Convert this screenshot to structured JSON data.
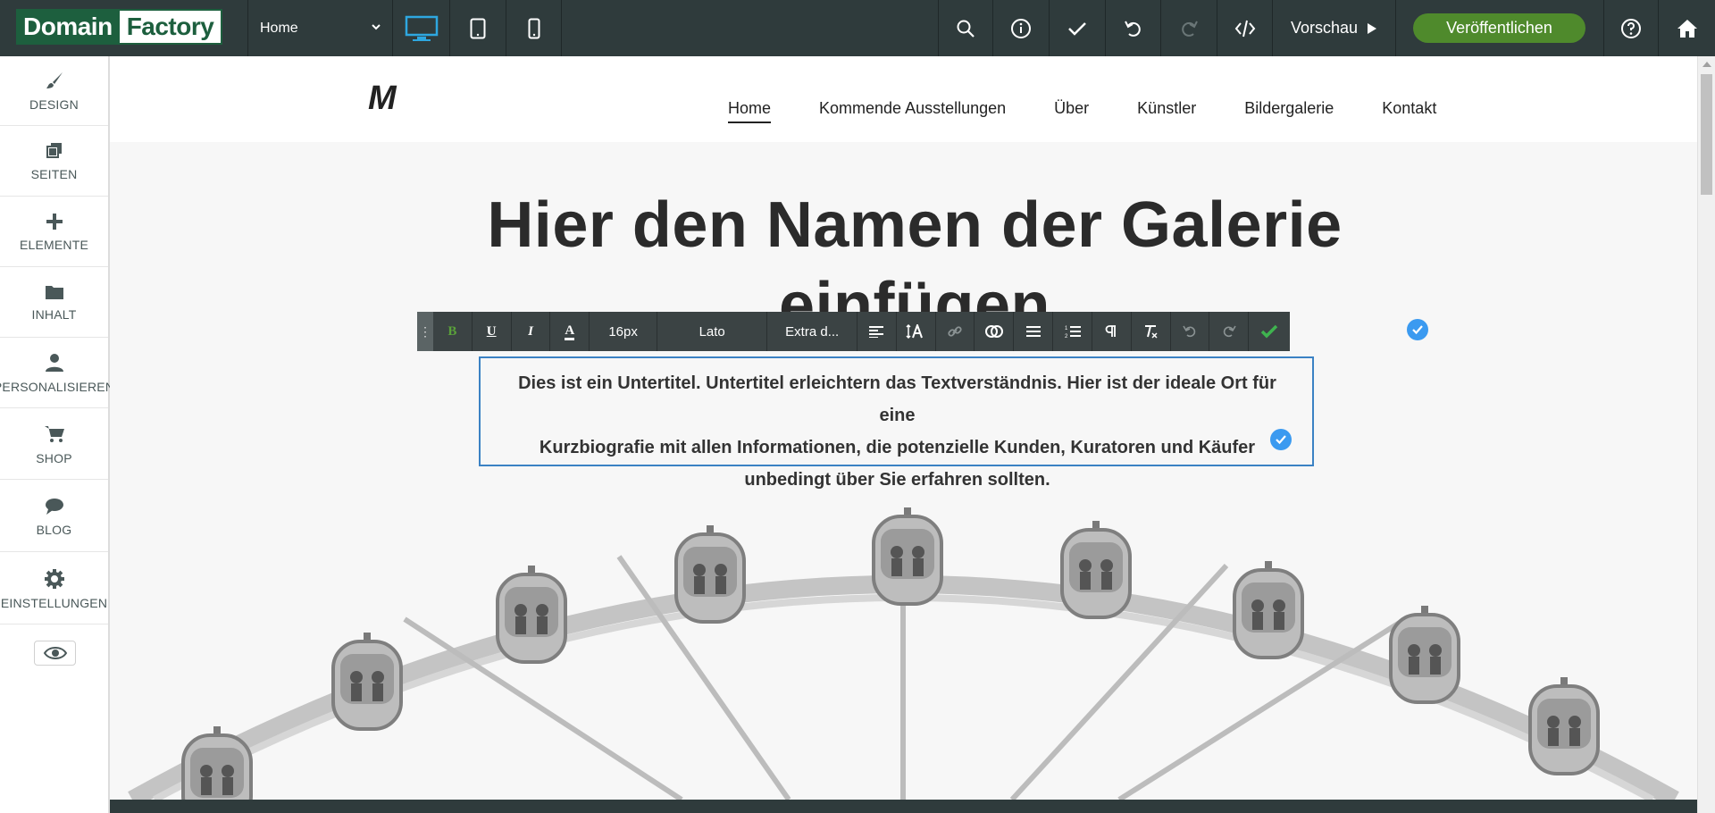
{
  "topbar": {
    "logo_part1": "Domain",
    "logo_part2": "Factory",
    "page_select_value": "Home",
    "preview_label": "Vorschau",
    "publish_label": "Veröffentlichen",
    "icons": [
      "desktop-icon",
      "tablet-icon",
      "mobile-icon",
      "search-icon",
      "info-icon",
      "check-icon",
      "undo-icon",
      "redo-icon",
      "code-icon",
      "help-icon",
      "home-icon"
    ]
  },
  "sidebar": {
    "items": [
      {
        "label": "DESIGN",
        "icon": "brush-icon"
      },
      {
        "label": "SEITEN",
        "icon": "pages-icon"
      },
      {
        "label": "ELEMENTE",
        "icon": "plus-icon"
      },
      {
        "label": "INHALT",
        "icon": "folder-icon"
      },
      {
        "label": "PERSONALISIEREN",
        "icon": "user-icon"
      },
      {
        "label": "SHOP",
        "icon": "cart-icon"
      },
      {
        "label": "BLOG",
        "icon": "chat-icon"
      },
      {
        "label": "EINSTELLUNGEN",
        "icon": "gear-icon"
      }
    ]
  },
  "site": {
    "logo": "M",
    "nav": [
      "Home",
      "Kommende Ausstellungen",
      "Über",
      "Künstler",
      "Bildergalerie",
      "Kontakt"
    ],
    "active_nav": "Home",
    "hero_title_line1": "Hier den Namen der Galerie",
    "hero_title_line2": "einfügen",
    "subtitle_lines": [
      "Dies ist ein Untertitel. Untertitel erleichtern das Textverständnis. Hier ist der ideale Ort für eine",
      "Kurzbiografie mit allen Informationen, die potenzielle Kunden, Kuratoren und Käufer",
      "unbedingt über Sie erfahren sollten."
    ]
  },
  "editor_toolbar": {
    "bold": "B",
    "underline": "U",
    "italic": "I",
    "font_color": "A",
    "font_size": "16px",
    "font_family": "Lato",
    "font_weight": "Extra d..."
  },
  "colors": {
    "topbar_bg": "#2f3b3c",
    "brand_green": "#1d5f3e",
    "publish_green": "#4f8a2c",
    "accent_blue": "#3b82c4",
    "device_active": "#2ea7e0"
  }
}
